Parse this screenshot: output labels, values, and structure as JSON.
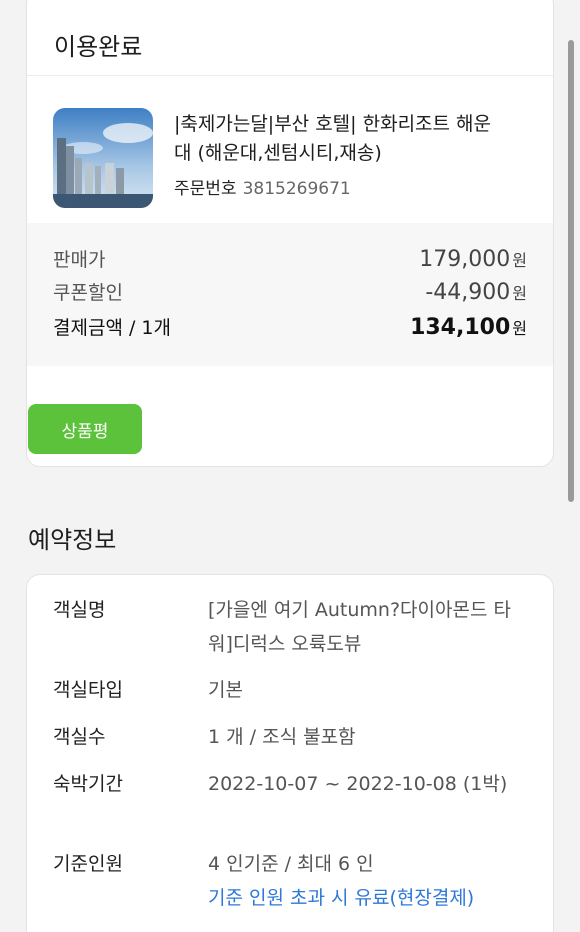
{
  "order_card": {
    "status": "이용완료",
    "product": {
      "name": "|축제가는달|부산 호텔| 한화리조트 해운대 (해운대,센텀시티,재송)",
      "order_label": "주문번호",
      "order_number": "3815269671"
    },
    "prices": [
      {
        "label": "판매가",
        "value": "179,000",
        "unit": "원"
      },
      {
        "label": "쿠폰할인",
        "value": "-44,900",
        "unit": "원"
      },
      {
        "label": "결제금액 / 1개",
        "value": "134,100",
        "unit": "원"
      }
    ],
    "review_button": "상품평"
  },
  "reservation": {
    "title": "예약정보",
    "rows": [
      {
        "key": "객실명",
        "value": "[가을엔 여기 Autumn?다이아몬드 타워]디럭스 오륙도뷰"
      },
      {
        "key": "객실타입",
        "value": "기본"
      },
      {
        "key": "객실수",
        "value": "1 개 / 조식 불포함"
      },
      {
        "key": "숙박기간",
        "value": "2022-10-07 ~ 2022-10-08 (1박)"
      },
      {
        "key": "기준인원",
        "value": "4 인기준 / 최대 6 인",
        "note": "기준 인원 초과 시 유료(현장결제)"
      }
    ]
  },
  "colors": {
    "accent_green": "#5cc13b",
    "note_blue": "#2f78d8"
  },
  "icons": {
    "thumbnail": "hotel-building-photo"
  }
}
